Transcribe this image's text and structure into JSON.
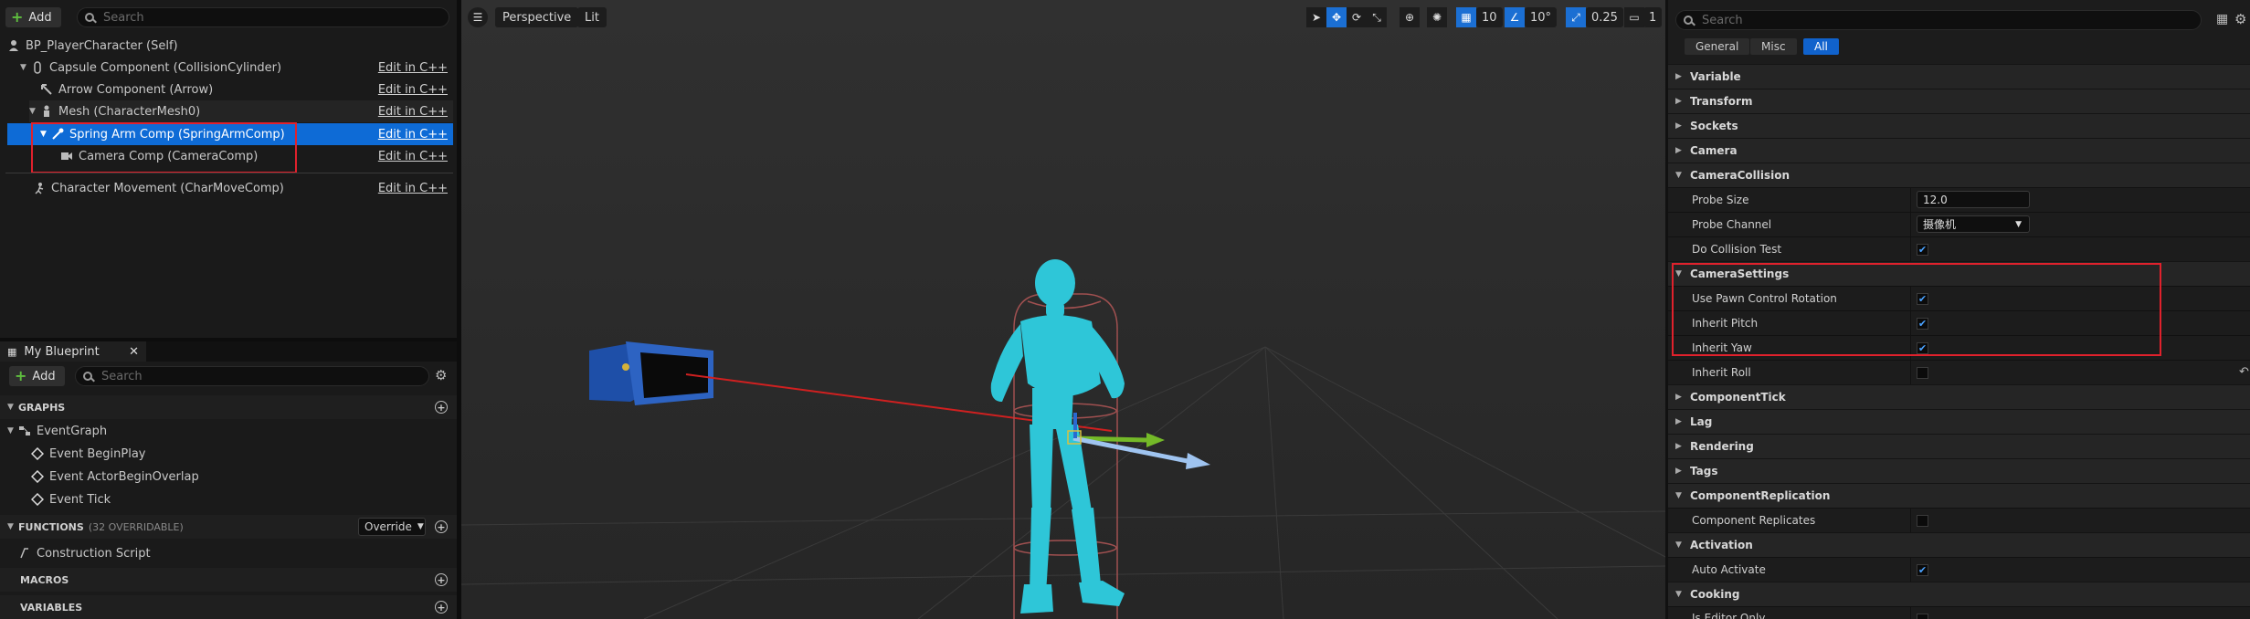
{
  "components": {
    "add_label": "Add",
    "search_placeholder": "Search",
    "items": [
      {
        "label": "BP_PlayerCharacter (Self)",
        "cpp": ""
      },
      {
        "label": "Capsule Component (CollisionCylinder)",
        "cpp": "Edit in C++"
      },
      {
        "label": "Arrow Component (Arrow)",
        "cpp": "Edit in C++"
      },
      {
        "label": "Mesh (CharacterMesh0)",
        "cpp": "Edit in C++"
      },
      {
        "label": "Spring Arm Comp (SpringArmComp)",
        "cpp": "Edit in C++"
      },
      {
        "label": "Camera Comp (CameraComp)",
        "cpp": "Edit in C++"
      },
      {
        "label": "Character Movement (CharMoveComp)",
        "cpp": "Edit in C++"
      }
    ]
  },
  "blueprint": {
    "tab_label": "My Blueprint",
    "add_label": "Add",
    "search_placeholder": "Search",
    "graphs_label": "GRAPHS",
    "event_graph": "EventGraph",
    "events": [
      "Event BeginPlay",
      "Event ActorBeginOverlap",
      "Event Tick"
    ],
    "functions_label": "FUNCTIONS",
    "functions_count": "(32 OVERRIDABLE)",
    "override_label": "Override",
    "construction_script": "Construction Script",
    "macros_label": "MACROS",
    "variables_label": "VARIABLES"
  },
  "viewport": {
    "perspective": "Perspective",
    "lit": "Lit",
    "grid_snap": "10",
    "rot_snap": "10°",
    "scale_snap": "0.25",
    "camera_speed": "1"
  },
  "details": {
    "search_placeholder": "Search",
    "tabs": [
      "General",
      "Misc",
      "All"
    ],
    "categories": {
      "variable": "Variable",
      "transform": "Transform",
      "sockets": "Sockets",
      "camera": "Camera",
      "camera_collision": "CameraCollision",
      "camera_settings": "CameraSettings",
      "component_tick": "ComponentTick",
      "lag": "Lag",
      "rendering": "Rendering",
      "tags": "Tags",
      "component_replication": "ComponentReplication",
      "activation": "Activation",
      "cooking": "Cooking"
    },
    "probe_size_label": "Probe Size",
    "probe_size_value": "12.0",
    "probe_channel_label": "Probe Channel",
    "probe_channel_value": "摄像机",
    "do_collision_label": "Do Collision Test",
    "use_pawn_label": "Use Pawn Control Rotation",
    "inherit_pitch_label": "Inherit Pitch",
    "inherit_yaw_label": "Inherit Yaw",
    "inherit_roll_label": "Inherit Roll",
    "component_replicates_label": "Component Replicates",
    "auto_activate_label": "Auto Activate",
    "is_editor_only_label": "Is Editor Only"
  },
  "colors": {
    "selection": "#0e6bd6",
    "highlight_box": "#e0212c",
    "mannequin": "#2ec6d8",
    "check": "#4aa2ff"
  }
}
